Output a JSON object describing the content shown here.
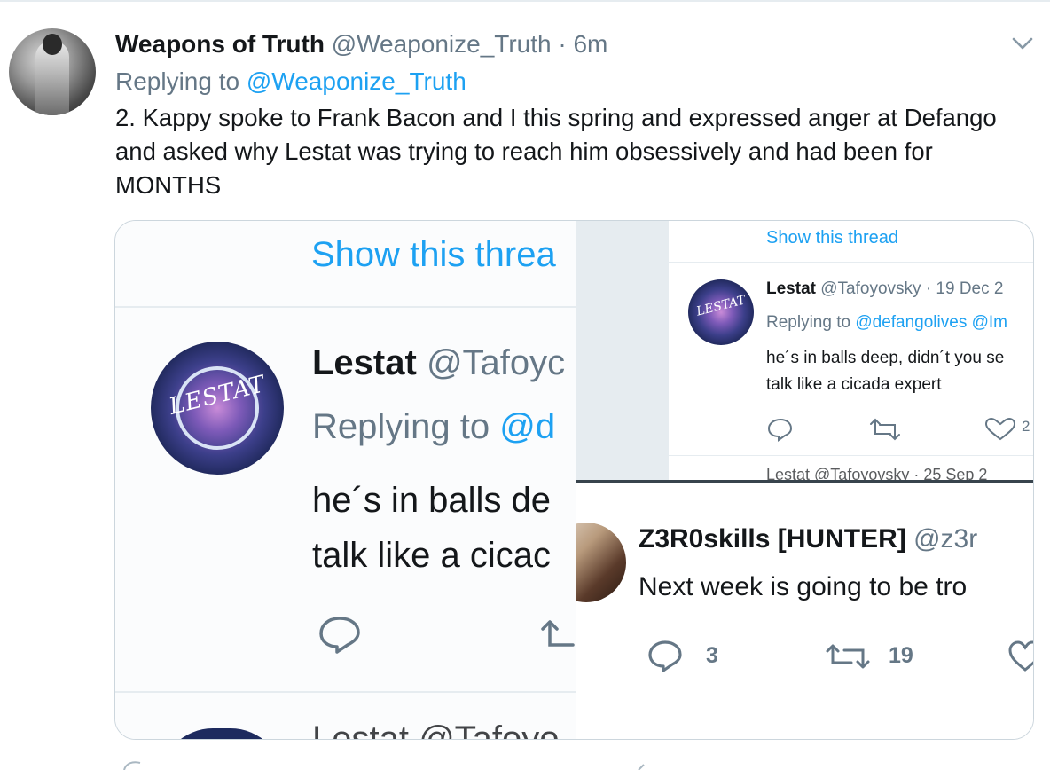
{
  "tweet": {
    "display_name": "Weapons of Truth",
    "handle": "@Weaponize_Truth",
    "separator": "·",
    "time": "6m",
    "replying_prefix": "Replying to",
    "replying_mention": "@Weaponize_Truth",
    "text": "2. Kappy spoke to Frank Bacon and I this spring and expressed anger at Defango and asked why Lestat was trying to reach him obsessively and had been for MONTHS"
  },
  "left_screenshot": {
    "show_thread": "Show this threa",
    "avatar_text": "LESTAT",
    "name": "Lestat",
    "handle": "@Tafoyc",
    "replying_prefix": "Replying to",
    "replying_mention": "@d",
    "text_line1": "he´s in balls de",
    "text_line2": "talk like a cicac",
    "next_name": "Lestat @Tafoyo"
  },
  "right_top_screenshot": {
    "show_thread": "Show this thread",
    "avatar_text": "LESTAT",
    "name": "Lestat",
    "handle": "@Tafoyovsky",
    "date": "· 19 Dec 2",
    "replying_prefix": "Replying to",
    "replying_mentions": "@defangolives @Im",
    "text_line1": "he´s in balls deep, didn´t you se",
    "text_line2": "talk like a cicada expert",
    "like_count": "2",
    "next_row": "Lestat @Tafoyovsky · 25 Sep 2"
  },
  "right_bottom_screenshot": {
    "name": "Z3R0skills [HUNTER]",
    "handle": "@z3r",
    "text": "Next week is going to be tro",
    "reply_count": "3",
    "retweet_count": "19"
  },
  "colors": {
    "link_blue": "#1da1f2",
    "secondary_gray": "#657786",
    "divider": "#e6ecf0"
  },
  "icons": [
    "chevron-down-icon",
    "reply-icon",
    "retweet-icon",
    "like-icon"
  ]
}
